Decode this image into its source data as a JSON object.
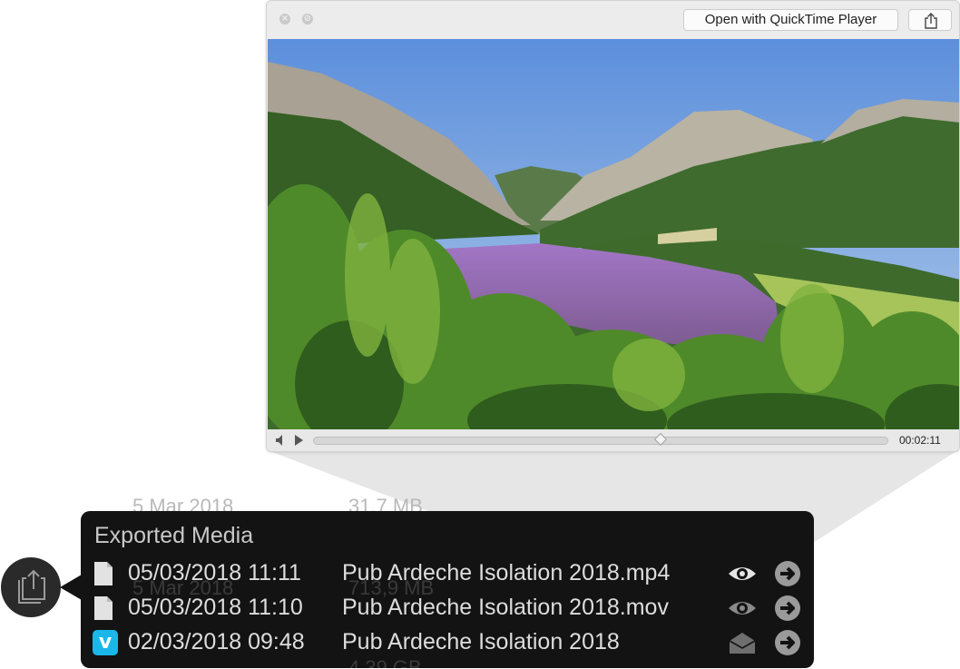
{
  "quicklook": {
    "open_with_label": "Open with QuickTime Player",
    "time": "00:02:11",
    "playback_progress": 0.605,
    "icons": {
      "close": "close-icon",
      "minimize": "minimize-icon",
      "share": "share-icon",
      "volume": "volume-icon",
      "play": "play-icon"
    }
  },
  "background_rows": [
    {
      "date": "5 Mar 2018",
      "size": "31,7 MB"
    },
    {
      "date": "5 Mar 2018",
      "size": "713,9 MB"
    },
    {
      "date": "",
      "size": "4,39 GB"
    }
  ],
  "exported_media": {
    "title": "Exported Media",
    "items": [
      {
        "date": "05/03/2018 11:11",
        "name": "Pub Ardeche Isolation 2018.mp4",
        "type_icon": "document-icon",
        "action_icon": "eye-icon",
        "action_enabled": true
      },
      {
        "date": "05/03/2018 11:10",
        "name": "Pub Ardeche Isolation 2018.mov",
        "type_icon": "document-icon",
        "action_icon": "eye-icon",
        "action_enabled": false
      },
      {
        "date": "02/03/2018 09:48",
        "name": "Pub Ardeche Isolation 2018",
        "type_icon": "vimeo-icon",
        "action_icon": "envelope-icon",
        "action_enabled": false
      }
    ],
    "vimeo_letter": "v"
  },
  "colors": {
    "popover_bg": "#131313",
    "vimeo": "#1ab7ea",
    "text": "#dddddd"
  }
}
